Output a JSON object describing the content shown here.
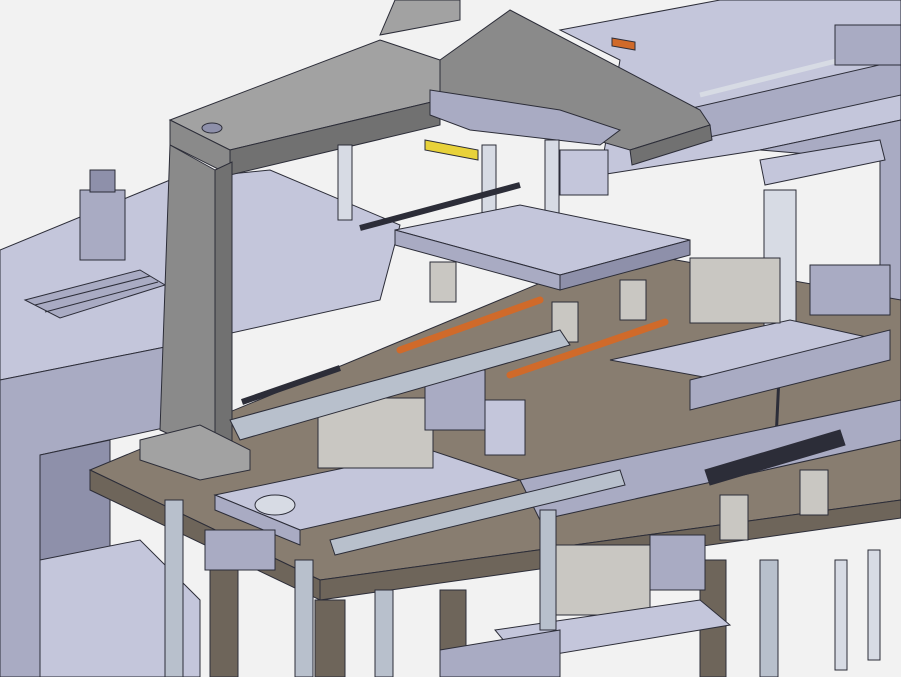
{
  "scene": {
    "subject": "cad-assembly-render",
    "colors": {
      "background": "#f2f2f2",
      "frame_light": "#c4c6db",
      "frame_mid": "#a9abc3",
      "frame_dark": "#8e90aa",
      "gantry_top": "#a2a2a2",
      "gantry_front": "#8a8a8a",
      "gantry_side": "#717171",
      "table_top": "#887d70",
      "table_edge": "#6e655a",
      "profile": "#b8c0cc",
      "steel": "#d7dbe4",
      "motor_box": "#c9c7c2",
      "copper": "#d06a2a",
      "yellow": "#e8d23a",
      "edge_line": "#2c2d38"
    }
  }
}
